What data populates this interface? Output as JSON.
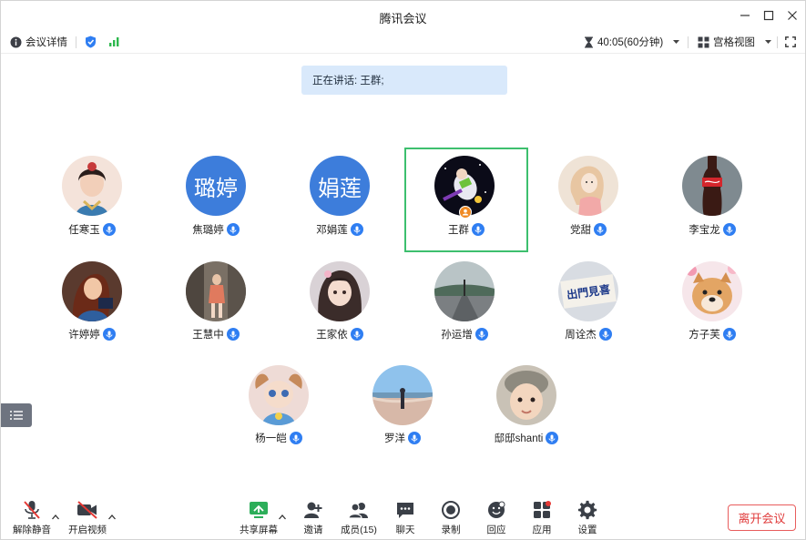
{
  "window": {
    "title": "腾讯会议"
  },
  "infobar": {
    "meeting_details": "会议详情",
    "timer": "40:05(60分钟)",
    "view_mode": "宫格视图"
  },
  "speaking": {
    "text": "正在讲话: 王群;"
  },
  "participants": [
    {
      "name": "任寒玉",
      "avatar": "portrait-illustration"
    },
    {
      "name": "焦璐婷",
      "avatar": "text",
      "avatar_text": "璐婷"
    },
    {
      "name": "邓娟莲",
      "avatar": "text",
      "avatar_text": "娟莲"
    },
    {
      "name": "王群",
      "avatar": "space-toy",
      "active_speaker": true,
      "host": true
    },
    {
      "name": "党甜",
      "avatar": "illustration-girl"
    },
    {
      "name": "李宝龙",
      "avatar": "cola-bottle"
    },
    {
      "name": "许婷婷",
      "avatar": "cartoon-princess"
    },
    {
      "name": "王慧中",
      "avatar": "photo-person"
    },
    {
      "name": "王家依",
      "avatar": "photo-girl"
    },
    {
      "name": "孙运增",
      "avatar": "road-landscape"
    },
    {
      "name": "周诠杰",
      "avatar": "sign-text"
    },
    {
      "name": "方子芙",
      "avatar": "dog-photo"
    },
    {
      "name": "杨一皑",
      "avatar": "toy-doll"
    },
    {
      "name": "罗洋",
      "avatar": "beach-photo"
    },
    {
      "name": "邸邸shanti",
      "avatar": "baby-photo"
    }
  ],
  "avatar_sign_text": "出門見喜",
  "toolbar": {
    "unmute": "解除静音",
    "start_video": "开启视频",
    "share_screen": "共享屏幕",
    "invite": "邀请",
    "members": "成员(15)",
    "chat": "聊天",
    "record": "录制",
    "reactions": "回应",
    "apps": "应用",
    "settings": "设置",
    "leave": "离开会议"
  },
  "colors": {
    "accent": "#2f7ef2",
    "active_border": "#3dbf6e",
    "leave": "#e03c3c",
    "banner": "#d9e9fb",
    "signal": "#2db84d"
  }
}
